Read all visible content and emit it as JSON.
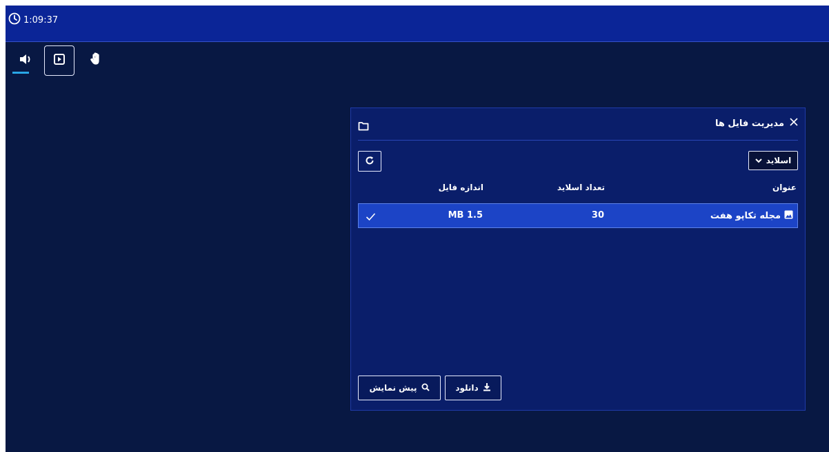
{
  "header": {
    "timer": "1:09:37"
  },
  "toolbar": {
    "icons": [
      "speaker-icon",
      "presentation-icon",
      "hand-raise-icon"
    ],
    "selected": "presentation-icon"
  },
  "file_manager": {
    "title": "مدیریت فایل ها",
    "type_select": {
      "value": "اسلاید"
    },
    "table": {
      "columns": [
        "عنوان",
        "تعداد اسلاید",
        "اندازه فایل"
      ],
      "rows": [
        {
          "title": "مجله تکاپو هفت",
          "slides": "30",
          "size": "1.5 MB",
          "selected": true
        }
      ]
    },
    "buttons": {
      "download": "دانلود",
      "preview": "پیش نمایش"
    }
  },
  "colors": {
    "background": "#081843",
    "topbar": "#0b2597",
    "panel": "#0a1e6a",
    "row_selected": "#1c44c6",
    "accent": "#29a6e6"
  }
}
